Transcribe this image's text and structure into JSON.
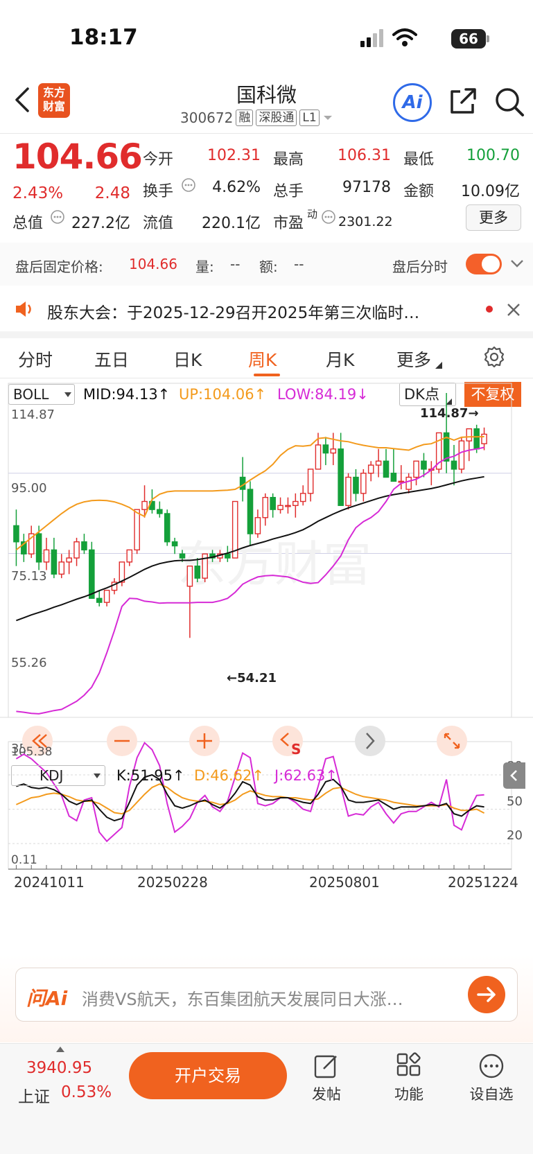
{
  "status": {
    "time": "18:17",
    "battery": "66"
  },
  "header": {
    "title": "国科微",
    "code": "300672",
    "tags": [
      "融",
      "深股通",
      "L1"
    ],
    "logo_text": [
      "东方",
      "财富"
    ],
    "ai_label": "Ai"
  },
  "quote": {
    "price": "104.66",
    "change_pct": "2.43%",
    "change": "2.48",
    "fields": [
      {
        "label": "今开",
        "value": "102.31",
        "color": "#e02c2c"
      },
      {
        "label": "最高",
        "value": "106.31",
        "color": "#e02c2c"
      },
      {
        "label": "最低",
        "value": "100.70",
        "color": "#14a03a"
      },
      {
        "label": "换手",
        "value": "4.62%",
        "color": "#222222"
      },
      {
        "label": "总手",
        "value": "97178",
        "color": "#222222"
      },
      {
        "label": "金额",
        "value": "10.09亿",
        "color": "#222222"
      },
      {
        "label": "总值",
        "value": "227.2亿",
        "color": "#222222"
      },
      {
        "label": "流值",
        "value": "220.1亿",
        "color": "#222222"
      },
      {
        "label": "市盈",
        "value": "2301.22",
        "color": "#222222"
      }
    ],
    "pe_superscript": "动",
    "more_button": "更多"
  },
  "after_hours": {
    "price_label": "盘后固定价格:",
    "price": "104.66",
    "vol_label": "量:",
    "vol": "--",
    "amt_label": "额:",
    "amt": "--",
    "switch_label": "盘后分时"
  },
  "notice": {
    "text": "股东大会：于2025-12-29召开2025年第三次临时…"
  },
  "tabs": [
    "分时",
    "五日",
    "日K",
    "周K",
    "月K",
    "更多"
  ],
  "boll": {
    "selector": "BOLL",
    "mid": "MID:94.13↑",
    "up": "UP:104.06↑",
    "low": "LOW:84.19↓",
    "dk_button": "DK点",
    "fq_button": "不复权",
    "y_labels": [
      "114.87",
      "95.00",
      "75.13",
      "55.26",
      "35.38"
    ],
    "high_marker": "114.87→",
    "low_marker": "←54.21",
    "watermark": "东方财富"
  },
  "kdj": {
    "selector": "KDJ",
    "k": "K:51.95↑",
    "d": "D:46.62↑",
    "j": "J:62.63↑",
    "y_labels": [
      "105.38",
      "0.11"
    ],
    "right_labels": [
      "80",
      "50",
      "20"
    ]
  },
  "x_dates": [
    "20241011",
    "20250228",
    "20250801",
    "20251224"
  ],
  "colors": {
    "up": "#e02c2c",
    "down": "#14a03a",
    "accent": "#f0621f",
    "mid": "#111111",
    "upper": "#f39a1c",
    "lower": "#d62ad6"
  },
  "ask": {
    "brand": "问Ai",
    "text": "消费VS航天，东百集团航天发展同日大涨…"
  },
  "bottom": {
    "index_value": "3940.95",
    "index_name": "上证",
    "index_pct": "0.53%",
    "open_button": "开户交易",
    "nav": [
      "发帖",
      "功能",
      "设自选"
    ]
  },
  "chart_data": {
    "type": "candlestick",
    "period": "weekly",
    "candles": [
      [
        82,
        86,
        72,
        78
      ],
      [
        78,
        80,
        73,
        75
      ],
      [
        75,
        82,
        74,
        80
      ],
      [
        80,
        82,
        71,
        73
      ],
      [
        73,
        79,
        71,
        76
      ],
      [
        76,
        79,
        69,
        70
      ],
      [
        70,
        75,
        69,
        73
      ],
      [
        73,
        76,
        70,
        74
      ],
      [
        74,
        79,
        72,
        78
      ],
      [
        78,
        80,
        75,
        76
      ],
      [
        76,
        78,
        64,
        64
      ],
      [
        64,
        66,
        62,
        63
      ],
      [
        63,
        66,
        62,
        66
      ],
      [
        66,
        69,
        65,
        68
      ],
      [
        68,
        73,
        67,
        73
      ],
      [
        73,
        76,
        72,
        76
      ],
      [
        76,
        85,
        75,
        86
      ],
      [
        86,
        92,
        84,
        88
      ],
      [
        88,
        91,
        85,
        86
      ],
      [
        86,
        88,
        84,
        85
      ],
      [
        85,
        86,
        77,
        78
      ],
      [
        78,
        79,
        75,
        77
      ],
      [
        75,
        76,
        73,
        74
      ],
      [
        67,
        72,
        54.21,
        72
      ],
      [
        72,
        74,
        68,
        69
      ],
      [
        69,
        75,
        68,
        75
      ],
      [
        75,
        76,
        73,
        74
      ],
      [
        74,
        76,
        73,
        75
      ],
      [
        75,
        77,
        73,
        74
      ],
      [
        74,
        88,
        74,
        88
      ],
      [
        94,
        99,
        88,
        91
      ],
      [
        91,
        93,
        77,
        80
      ],
      [
        80,
        86,
        79,
        84
      ],
      [
        84,
        90,
        82,
        89
      ],
      [
        89,
        90,
        84,
        86
      ],
      [
        86,
        89,
        85,
        87
      ],
      [
        87,
        89,
        85,
        87
      ],
      [
        87,
        90,
        84,
        88
      ],
      [
        88,
        92,
        87,
        90
      ],
      [
        90,
        96,
        88,
        96
      ],
      [
        96,
        105,
        96,
        102
      ],
      [
        102,
        104,
        97,
        100
      ],
      [
        100,
        105,
        97,
        101
      ],
      [
        101,
        105,
        87,
        87
      ],
      [
        87,
        95,
        86,
        94
      ],
      [
        94,
        96,
        88,
        90
      ],
      [
        90,
        96,
        88,
        95
      ],
      [
        95,
        98,
        93,
        97
      ],
      [
        97,
        101,
        94,
        98
      ],
      [
        98,
        101,
        94,
        94
      ],
      [
        95,
        101,
        93,
        93
      ],
      [
        93,
        97,
        91,
        93
      ],
      [
        91,
        95,
        90,
        94
      ],
      [
        94,
        98,
        92,
        98
      ],
      [
        98,
        100,
        94,
        96
      ],
      [
        96,
        98,
        92,
        96
      ],
      [
        96,
        104,
        95,
        105
      ],
      [
        105,
        114.87,
        95,
        98
      ],
      [
        98,
        102,
        92,
        96
      ],
      [
        96,
        104,
        95,
        103
      ],
      [
        103,
        106,
        98,
        106
      ],
      [
        106,
        107,
        100,
        101
      ],
      [
        102.31,
        106.31,
        100.7,
        104.66
      ]
    ],
    "boll_mid": [
      58.5,
      59.2,
      59.9,
      60.5,
      61.1,
      61.8,
      62.4,
      63.1,
      63.8,
      64.4,
      65.1,
      65.9,
      66.6,
      67.4,
      68.3,
      69.2,
      70.2,
      71.2,
      72.0,
      72.6,
      73.0,
      73.3,
      73.4,
      73.4,
      73.6,
      73.9,
      74.2,
      74.7,
      75.2,
      75.8,
      76.5,
      77.1,
      77.6,
      78.1,
      78.7,
      79.2,
      79.7,
      80.3,
      81.0,
      82.0,
      83.1,
      84.0,
      84.9,
      85.7,
      86.4,
      87.0,
      87.6,
      88.2,
      88.8,
      89.3,
      89.7,
      90.0,
      90.3,
      90.6,
      90.9,
      91.2,
      91.6,
      92.1,
      92.6,
      93.1,
      93.5,
      93.8,
      94.13
    ],
    "boll_up": [
      76,
      77.5,
      79,
      80.5,
      82,
      83.5,
      85,
      86.3,
      87.3,
      87.9,
      88.2,
      88.3,
      88.2,
      87.9,
      87.3,
      86.5,
      85.2,
      84.3,
      88.5,
      89.8,
      90.4,
      90.6,
      90.6,
      90.6,
      90.6,
      90.6,
      90.6,
      90.7,
      90.8,
      91.0,
      92.0,
      93.3,
      94.5,
      95.6,
      97.2,
      99.4,
      100.9,
      101.8,
      101.7,
      101.9,
      103.6,
      103.8,
      103.4,
      103.0,
      102.8,
      102.3,
      101.9,
      101.6,
      101.3,
      101.3,
      101.1,
      100.9,
      100.7,
      101.5,
      102.1,
      102.3,
      103.1,
      103.9,
      103.2,
      103.9,
      104.0,
      104.0,
      104.06
    ],
    "boll_low": [
      36,
      35.8,
      35.5,
      35.4,
      35.8,
      36.2,
      36.5,
      37.5,
      38.5,
      40,
      42,
      45.5,
      50.5,
      56,
      62,
      64,
      63.9,
      63.3,
      63.1,
      62.8,
      62.9,
      62.9,
      62.9,
      62.9,
      63.0,
      63.0,
      63.0,
      63.4,
      64.0,
      65.5,
      67.5,
      68.5,
      69.3,
      69.6,
      69.7,
      69.5,
      69.3,
      68.7,
      68.0,
      67.7,
      67.9,
      69.8,
      72.0,
      74.5,
      78.5,
      81.5,
      83.0,
      84.0,
      85.5,
      88.0,
      91.0,
      92.5,
      93.0,
      93.5,
      94.5,
      95.8,
      97.6,
      98.7,
      99.2,
      100.2,
      100.7,
      101.0,
      101.4
    ],
    "k": [
      70,
      72,
      69,
      68,
      69,
      67,
      63,
      57,
      54,
      57,
      58,
      50,
      43,
      40,
      42,
      56,
      71,
      78,
      80,
      76,
      63,
      53,
      51,
      53,
      56,
      58,
      54,
      51,
      56,
      64,
      74,
      71,
      61,
      58,
      58,
      60,
      60,
      58,
      56,
      55,
      63,
      74,
      76,
      70,
      58,
      56,
      56,
      57,
      58,
      54,
      50,
      52,
      52,
      52,
      53,
      54,
      53,
      55,
      46,
      44,
      49,
      53,
      51.95
    ],
    "d": [
      54,
      57,
      60,
      61,
      63,
      64,
      63,
      61,
      58,
      57,
      57,
      55,
      51,
      47,
      46,
      49,
      56,
      63,
      69,
      72,
      69,
      64,
      60,
      58,
      57,
      57,
      56,
      54,
      55,
      58,
      63,
      66,
      64,
      62,
      61,
      61,
      60,
      60,
      59,
      58,
      59,
      64,
      68,
      69,
      66,
      63,
      61,
      60,
      59,
      58,
      56,
      55,
      54,
      53,
      53,
      53,
      53,
      54,
      51,
      49,
      49,
      50,
      46.62
    ],
    "j": [
      94,
      98,
      94,
      88,
      82,
      72,
      62,
      44,
      40,
      58,
      60,
      30,
      22,
      28,
      34,
      70,
      95,
      108,
      102,
      88,
      55,
      30,
      35,
      42,
      56,
      62,
      52,
      48,
      57,
      78,
      99,
      95,
      55,
      53,
      55,
      60,
      60,
      56,
      50,
      48,
      70,
      94,
      96,
      70,
      44,
      46,
      45,
      52,
      56,
      46,
      38,
      46,
      48,
      48,
      52,
      56,
      52,
      76,
      36,
      32,
      49,
      62,
      62.63
    ],
    "y_range_boll": [
      35.38,
      114.87
    ],
    "y_range_kdj": [
      0.11,
      105.38
    ]
  }
}
